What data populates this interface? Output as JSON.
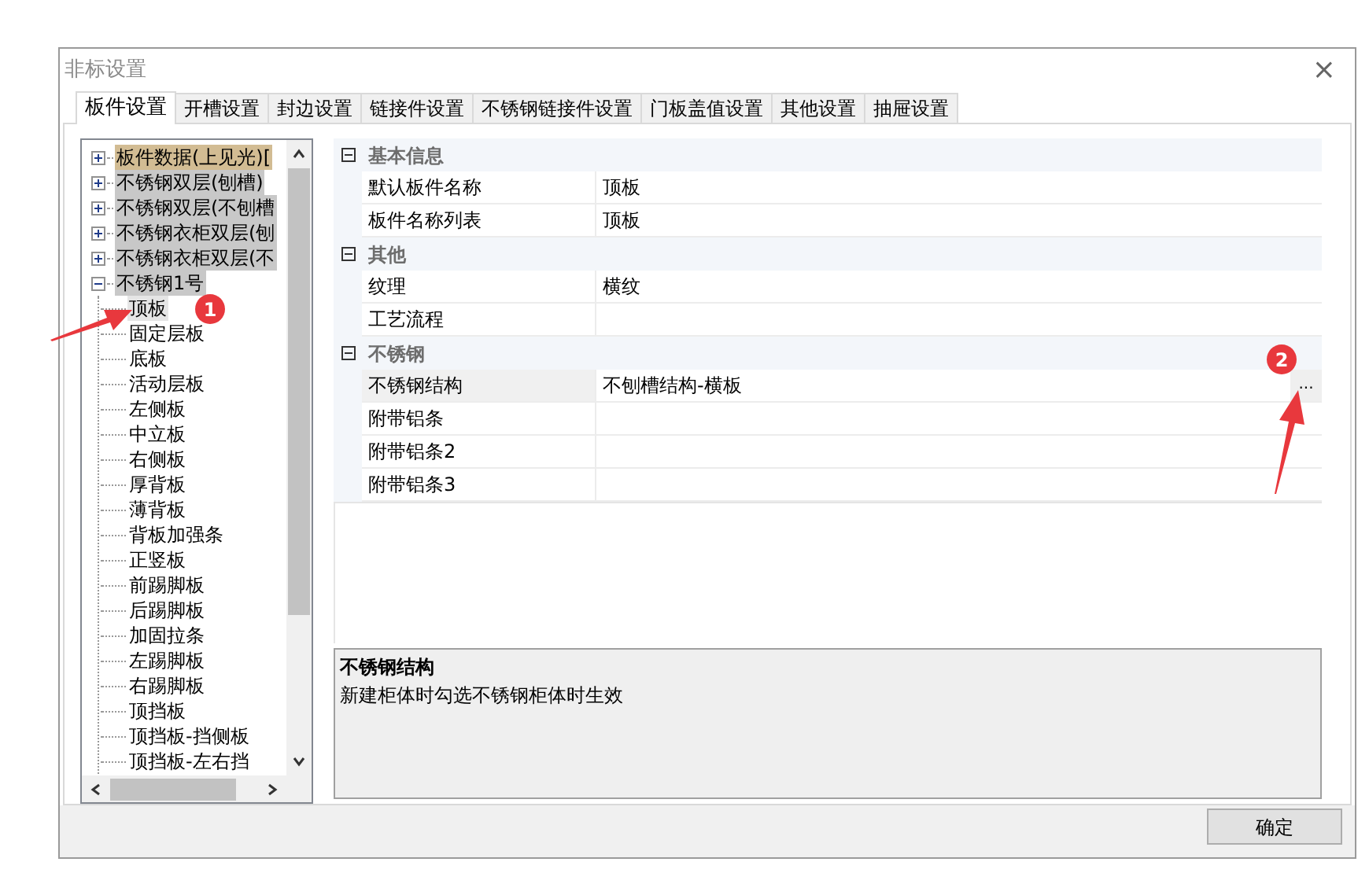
{
  "window": {
    "title": "非标设置",
    "close": "×"
  },
  "tabs": [
    {
      "label": "板件设置",
      "selected": true
    },
    {
      "label": "开槽设置",
      "selected": false
    },
    {
      "label": "封边设置",
      "selected": false
    },
    {
      "label": "链接件设置",
      "selected": false
    },
    {
      "label": "不锈钢链接件设置",
      "selected": false
    },
    {
      "label": "门板盖值设置",
      "selected": false
    },
    {
      "label": "其他设置",
      "selected": false
    },
    {
      "label": "抽屉设置",
      "selected": false
    }
  ],
  "tree": [
    {
      "label": "板件数据(上见光)[",
      "selected": true,
      "expanded": false
    },
    {
      "label": "不锈钢双层(刨槽)",
      "selected": false,
      "expanded": false
    },
    {
      "label": "不锈钢双层(不刨槽",
      "selected": false,
      "expanded": false
    },
    {
      "label": "不锈钢衣柜双层(刨",
      "selected": false,
      "expanded": false
    },
    {
      "label": "不锈钢衣柜双层(不",
      "selected": false,
      "expanded": false
    },
    {
      "label": "不锈钢1号",
      "selected": false,
      "expanded": true,
      "children": [
        {
          "label": "顶板",
          "selected": true
        },
        {
          "label": "固定层板",
          "selected": false
        },
        {
          "label": "底板",
          "selected": false
        },
        {
          "label": "活动层板",
          "selected": false
        },
        {
          "label": "左侧板",
          "selected": false
        },
        {
          "label": "中立板",
          "selected": false
        },
        {
          "label": "右侧板",
          "selected": false
        },
        {
          "label": "厚背板",
          "selected": false
        },
        {
          "label": "薄背板",
          "selected": false
        },
        {
          "label": "背板加强条",
          "selected": false
        },
        {
          "label": "正竖板",
          "selected": false
        },
        {
          "label": "前踢脚板",
          "selected": false
        },
        {
          "label": "后踢脚板",
          "selected": false
        },
        {
          "label": "加固拉条",
          "selected": false
        },
        {
          "label": "左踢脚板",
          "selected": false
        },
        {
          "label": "右踢脚板",
          "selected": false
        },
        {
          "label": "顶挡板",
          "selected": false
        },
        {
          "label": "顶挡板-挡侧板",
          "selected": false
        },
        {
          "label": "顶挡板-左右挡",
          "selected": false
        }
      ]
    }
  ],
  "properties": [
    {
      "category": "基本信息",
      "expanded": true,
      "rows": [
        {
          "name": "默认板件名称",
          "value": "顶板",
          "selected": false
        },
        {
          "name": "板件名称列表",
          "value": "顶板",
          "selected": false
        }
      ]
    },
    {
      "category": "其他",
      "expanded": true,
      "rows": [
        {
          "name": "纹理",
          "value": "横纹",
          "selected": false
        },
        {
          "name": "工艺流程",
          "selected": false
        }
      ]
    },
    {
      "category": "不锈钢",
      "expanded": true,
      "rows": [
        {
          "name": "不锈钢结构",
          "value": "不刨槽结构-横板",
          "selected": true,
          "button": "..."
        },
        {
          "name": "附带铝条",
          "selected": false
        },
        {
          "name": "附带铝条2",
          "selected": false
        },
        {
          "name": "附带铝条3",
          "selected": false
        }
      ]
    }
  ],
  "description": {
    "title": "不锈钢结构",
    "text": "新建柜体时勾选不锈钢柜体时生效"
  },
  "buttons": [
    "确定"
  ],
  "annotations": [
    {
      "label": "1"
    },
    {
      "label": "2"
    }
  ]
}
